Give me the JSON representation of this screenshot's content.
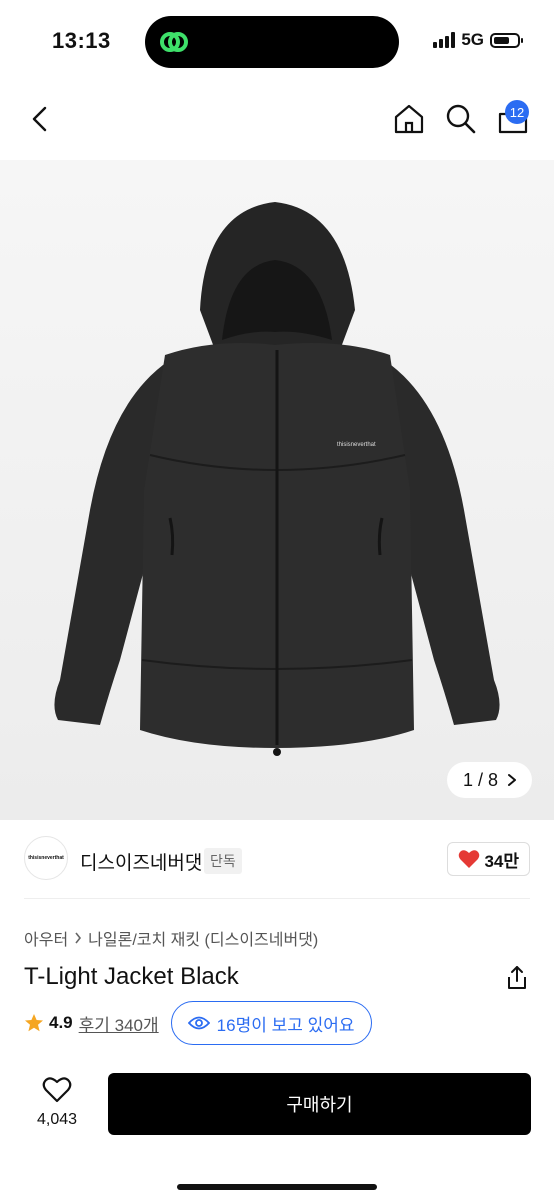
{
  "status": {
    "time": "13:13",
    "network": "5G",
    "battery_level": 0.7
  },
  "nav": {
    "cart_count": "12",
    "icons": [
      "chevron-left-icon",
      "home-icon",
      "search-icon",
      "shopping-bag-icon"
    ]
  },
  "image": {
    "counter": "1 / 8",
    "chest_logo": "thisisneverthat"
  },
  "brand": {
    "logo_text": "thisisneverthat",
    "name": "디스이즈네버댓",
    "tag": "단독",
    "likes": "34만"
  },
  "breadcrumb": [
    "아우터",
    "나일론/코치 재킷 (디스이즈네버댓)"
  ],
  "product": {
    "title": "T-Light Jacket Black",
    "rating": "4.9",
    "reviews": "후기 340개",
    "viewers": "16명이 보고 있어요"
  },
  "bottom": {
    "wish_count": "4,043",
    "buy_label": "구매하기"
  },
  "colors": {
    "accent": "#2b6cf2",
    "like": "#e53935",
    "star": "#f5a623"
  }
}
